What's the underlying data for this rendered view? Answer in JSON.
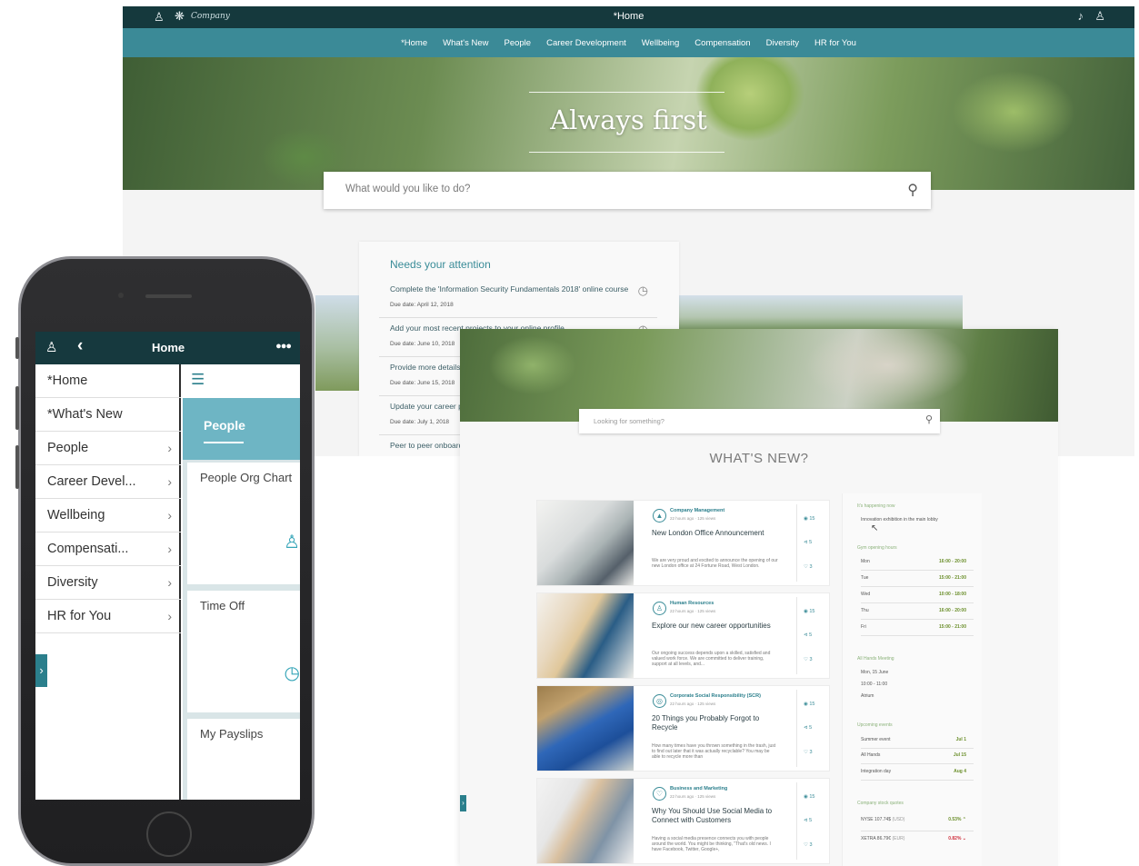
{
  "desktop": {
    "topbar": {
      "title": "*Home",
      "logo_text": "Company"
    },
    "nav": [
      "*Home",
      "What's New",
      "People",
      "Career Development",
      "Wellbeing",
      "Compensation",
      "Diversity",
      "HR for You"
    ],
    "hero_headline": "Always first",
    "search_placeholder": "What would you like to do?",
    "attention": {
      "heading": "Needs your attention",
      "items": [
        {
          "title": "Complete the 'Information Security Fundamentals 2018' online course",
          "due": "Due date: April 12, 2018"
        },
        {
          "title": "Add your most recent projects to your online profile",
          "due": "Due date: June 10, 2018"
        },
        {
          "title": "Provide more details",
          "due": "Due date: June 15, 2018"
        },
        {
          "title": "Update your career p",
          "due": "Due date: July 1, 2018"
        },
        {
          "title": "Peer to peer onboard",
          "due": ""
        }
      ]
    }
  },
  "whats_new": {
    "search_placeholder": "Looking for something?",
    "heading": "WHAT'S NEW?",
    "cards": [
      {
        "category": "Company Management",
        "meta": "22 hours ago · 125 views",
        "title": "New London Office Announcement",
        "desc": "We are very proud and excited to announce the opening of our new London office at 24 Fortune Road, West London.",
        "views": "15",
        "shares": "5",
        "likes": "3"
      },
      {
        "category": "Human Resources",
        "meta": "22 hours ago · 125 views",
        "title": "Explore our new career opportunities",
        "desc": "Our ongoing success depends upon a skilled, satisfied and valued work force. We are committed to deliver training, support at all levels, and...",
        "views": "15",
        "shares": "5",
        "likes": "3"
      },
      {
        "category": "Corporate Social Responsibility (SCR)",
        "meta": "22 hours ago · 125 views",
        "title": "20 Things you Probably Forgot to Recycle",
        "desc": "How many times have you thrown something in the trash, just to find out later that it was actually recyclable? You may be able to recycle more than",
        "views": "15",
        "shares": "5",
        "likes": "3"
      },
      {
        "category": "Business and Marketing",
        "meta": "22 hours ago · 125 views",
        "title": "Why You Should Use Social Media to Connect with Customers",
        "desc": "Having a social media presence connects you with people around the world. You might be thinking, \"That's old news. I have Facebook, Twitter, Google+,",
        "views": "15",
        "shares": "5",
        "likes": "3"
      }
    ],
    "sidebar": {
      "happening_heading": "It's happening now",
      "happening_item": "Innovation exhibition in the main lobby",
      "gym_heading": "Gym opening hours",
      "gym": [
        {
          "day": "Mon",
          "hours": "16:00 - 20:00"
        },
        {
          "day": "Tue",
          "hours": "15:00 - 21:00"
        },
        {
          "day": "Wed",
          "hours": "10:00 - 18:00"
        },
        {
          "day": "Thu",
          "hours": "16:00 - 20:00"
        },
        {
          "day": "Fri",
          "hours": "15:00 - 21:00"
        }
      ],
      "allhands_heading": "All Hands Meeting",
      "allhands_date": "Mon, 15 June",
      "allhands_time": "10:00 - 11:00",
      "allhands_place": "Atrium",
      "events_heading": "Upcoming events",
      "events": [
        {
          "name": "Summer event",
          "date": "Jul 1"
        },
        {
          "name": "All Hands",
          "date": "Jul 15"
        },
        {
          "name": "Integration day",
          "date": "Aug 4"
        }
      ],
      "stocks_heading": "Company stock quotes",
      "stocks": [
        {
          "name": "NYSE 107.74$",
          "unit": "(USD)",
          "change": "0.53%",
          "dir": "up"
        },
        {
          "name": "XETRA 86.79€",
          "unit": "(EUR)",
          "change": "0.82%",
          "dir": "down"
        }
      ]
    }
  },
  "phone": {
    "header_title": "Home",
    "menu": [
      {
        "label": "*Home",
        "chevron": false
      },
      {
        "label": "*What's New",
        "chevron": false
      },
      {
        "label": "People",
        "chevron": true
      },
      {
        "label": "Career Devel...",
        "chevron": true
      },
      {
        "label": "Wellbeing",
        "chevron": true
      },
      {
        "label": "Compensati...",
        "chevron": true
      },
      {
        "label": "Diversity",
        "chevron": true
      },
      {
        "label": "HR for You",
        "chevron": true
      }
    ],
    "section_title": "People",
    "tiles": [
      "People Org Chart",
      "Time Off",
      "My Payslips"
    ]
  }
}
